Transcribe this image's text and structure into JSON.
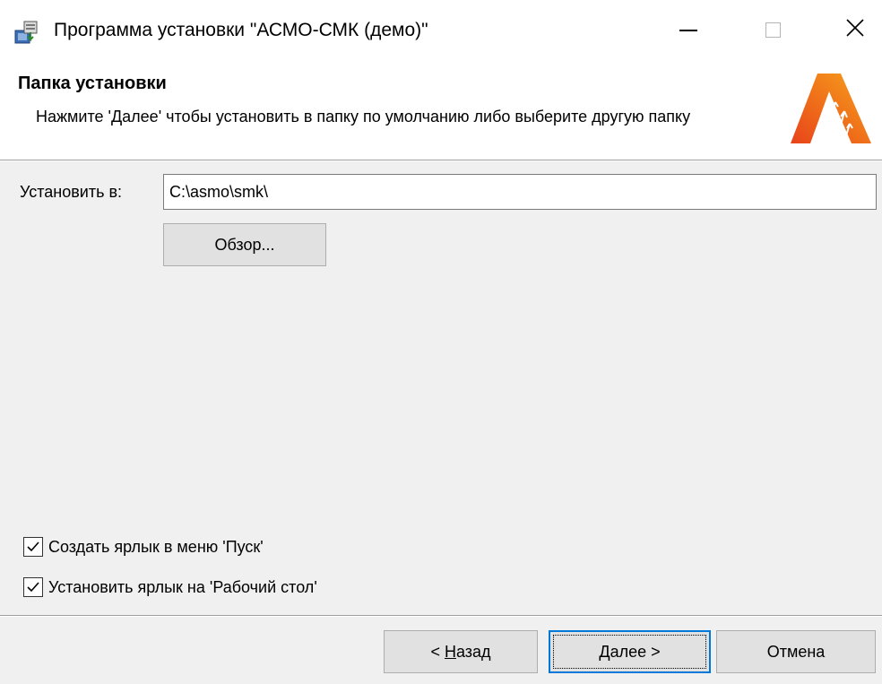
{
  "window": {
    "title": "Программа установки \"АСМО-СМК (демо)\""
  },
  "header": {
    "title": "Папка установки",
    "description": "Нажмите 'Далее' чтобы установить в папку по умолчанию либо выберите другую папку"
  },
  "install": {
    "label": "Установить в:",
    "path": "C:\\asmo\\smk\\"
  },
  "buttons": {
    "browse": "Обзор...",
    "back_prefix": "< ",
    "back_mnemonic": "Н",
    "back_rest": "азад",
    "next_mnemonic": "Д",
    "next_rest": "алее >",
    "cancel": "Отмена"
  },
  "options": [
    {
      "label": "Создать ярлык в меню 'Пуск'",
      "checked": true
    },
    {
      "label": "Установить ярлык на 'Рабочий стол'",
      "checked": true
    }
  ],
  "colors": {
    "logo_primary": "#e8431a",
    "logo_secondary": "#f7a21b",
    "focus_border": "#0078d7",
    "window_bg": "#f0f0f0"
  },
  "icons": {
    "app": "installer-icon",
    "logo": "asmo-logo",
    "minimize": "minimize-icon",
    "maximize": "maximize-icon",
    "close": "close-icon",
    "check": "checkmark-icon"
  }
}
